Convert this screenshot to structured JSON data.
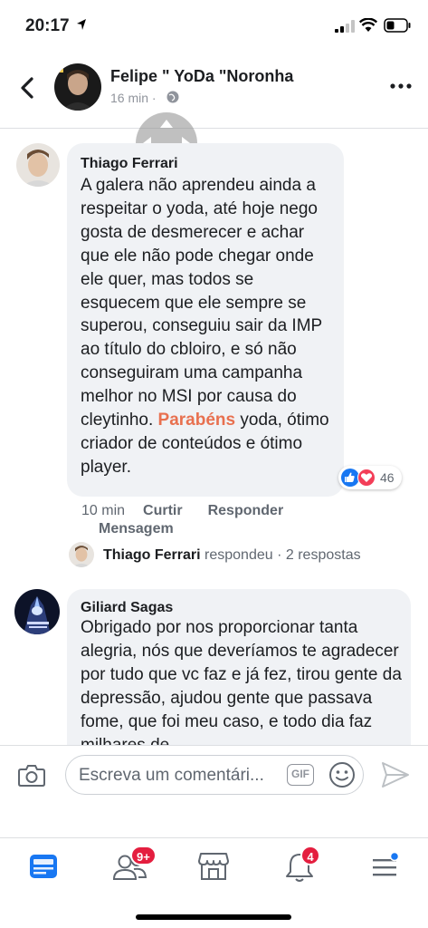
{
  "status_bar": {
    "time": "20:17"
  },
  "header": {
    "name": "Felipe \" YoDa \"Noronha",
    "time": "16 min ·"
  },
  "comments": [
    {
      "author": "Thiago Ferrari",
      "text_before": "A galera não aprendeu ainda a respeitar o yoda, até hoje nego gosta de desmerecer e achar que ele não pode chegar onde ele quer, mas todos se esquecem que ele sempre se superou, conseguiu sair da IMP ao título do cbloiro, e só não conseguiram uma campanha melhor no MSI por causa do cleytinho. ",
      "mention": "Parabéns",
      "text_after": " yoda, ótimo criador de conteúdos e ótimo player.",
      "time": "10 min",
      "like_label": "Curtir",
      "reply_label": "Responder",
      "message_label": "Mensagem",
      "reaction_count": "46",
      "reply_summary": {
        "author": "Thiago Ferrari",
        "verb": "respondeu",
        "count": "· 2 respostas"
      }
    },
    {
      "author": "Giliard Sagas",
      "text": "Obrigado por nos proporcionar tanta alegria, nós que deveríamos te agradecer por tudo que vc faz e já fez, tirou gente da depressão, ajudou gente que passava fome, que foi meu caso, e todo dia faz milhares de"
    }
  ],
  "composer": {
    "placeholder": "Escreva um comentári...",
    "gif_label": "GIF"
  },
  "nav": {
    "friends_badge": "9+",
    "notifications_badge": "4"
  },
  "colors": {
    "accent": "#1877f2",
    "mention": "#e8704f",
    "badge": "#e41e3f",
    "bubble": "#f0f2f5"
  }
}
